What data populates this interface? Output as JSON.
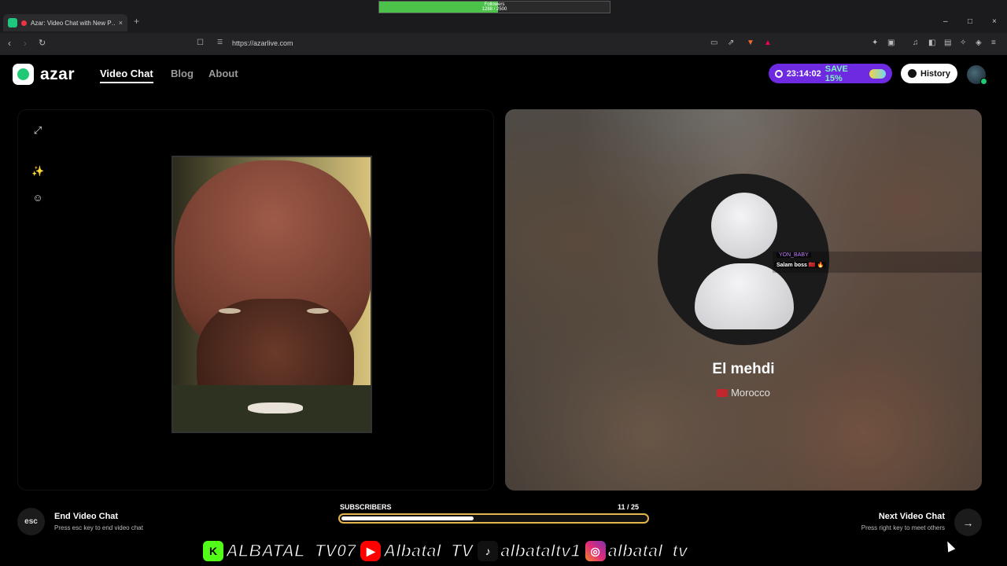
{
  "browser": {
    "tab_title": "Azar: Video Chat with New P…",
    "tab_close": "×",
    "new_tab": "+",
    "url": "https://azarlive.com",
    "window_controls": [
      "–",
      "□",
      "×"
    ]
  },
  "stream_overlay": {
    "followers_label": "Followers",
    "followers_value": "1288 / 2500",
    "followers_progress": 0.515,
    "subscribers_label": "SUBSCRIBERS",
    "subscribers_value": "11 / 25",
    "subscribers_progress": 0.44,
    "accent_color": "#e5b44a"
  },
  "site": {
    "logo_text": "azar",
    "nav": [
      "Video Chat",
      "Blog",
      "About"
    ],
    "promo_timer": "23:14:02",
    "promo_save": "SAVE 15%",
    "history_label": "History",
    "brand_color": "#1fc976",
    "promo_color": "#6d2ae0"
  },
  "left_panel": {
    "tools": [
      "expand-icon",
      "magic-wand-icon",
      "sticker-icon"
    ]
  },
  "peer": {
    "name": "El mehdi",
    "country": "Morocco"
  },
  "chat": {
    "user": "YON_BABY",
    "message": "Salam boss 🇲🇦 🔥"
  },
  "controls": {
    "esc_label": "esc",
    "end_title": "End Video Chat",
    "end_sub": "Press esc key to end video chat",
    "next_title": "Next Video Chat",
    "next_sub": "Press right key to meet others",
    "next_icon": "→"
  },
  "social": [
    {
      "icon": "kick-icon",
      "glyph": "K",
      "handle": "ALBATAL_TV07"
    },
    {
      "icon": "youtube-icon",
      "glyph": "▶",
      "handle": "Albatal_TV"
    },
    {
      "icon": "tiktok-icon",
      "glyph": "♪",
      "handle": "albataltv1"
    },
    {
      "icon": "instagram-icon",
      "glyph": "◎",
      "handle": "albatal_tv"
    }
  ]
}
